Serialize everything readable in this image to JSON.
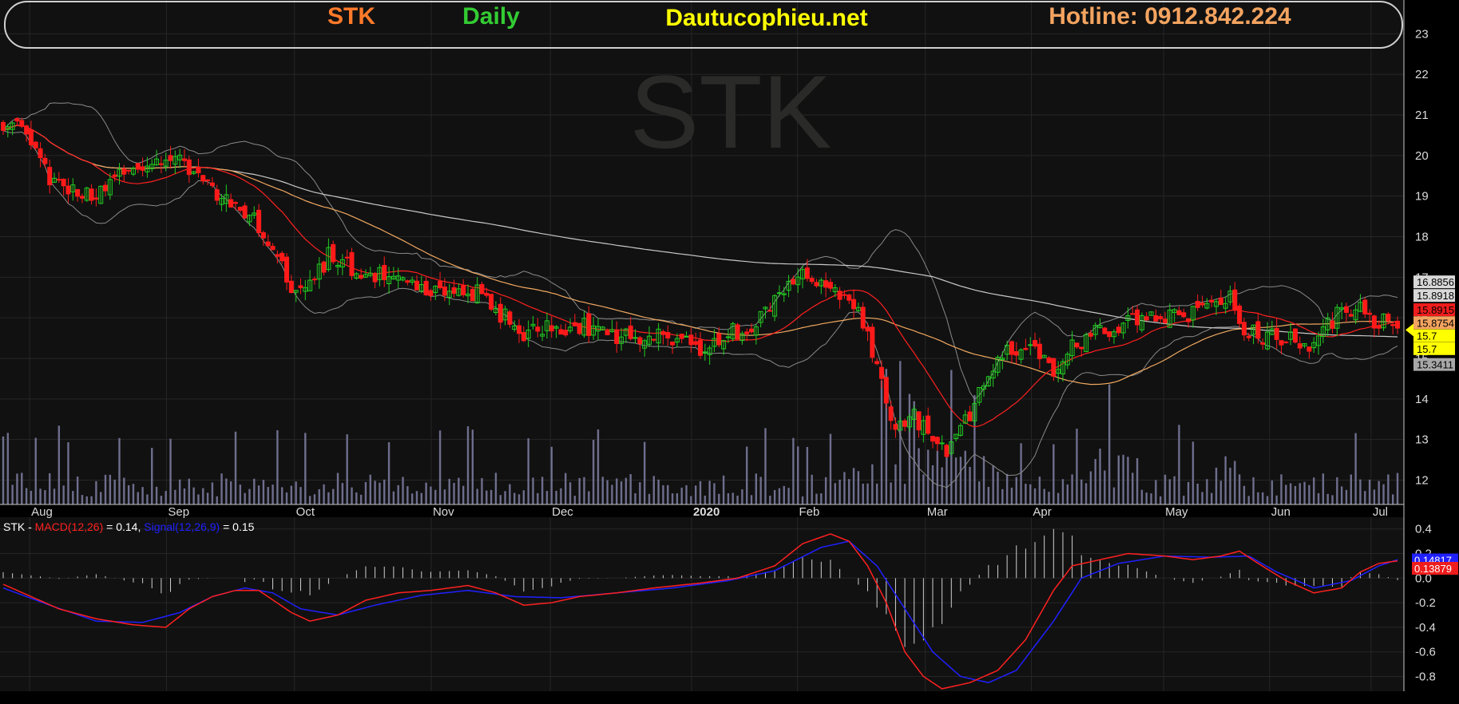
{
  "header": {
    "ticker": "STK",
    "period": "Daily",
    "site": "Dautucophieu.net",
    "hotline": "Hotline: 0912.842.224"
  },
  "watermark": "STK",
  "colors": {
    "background": "#111111",
    "up_candle": "#22cc22",
    "down_candle": "#ff1a1a",
    "ma_short": "#ff2020",
    "ma_mid": "#f0a860",
    "ma_long": "#c8c8c8",
    "bollinger": "#8a8a8a",
    "volume": "#6e6e8e",
    "macd_line": "#ff2020",
    "signal_line": "#2020ff",
    "header_ticker": "#ff7a2a",
    "header_period": "#33cc33",
    "header_site": "#ffff00",
    "header_hotline": "#f4a460"
  },
  "macd_panel": {
    "prefix": "STK - ",
    "macd_name": "MACD(12,26)",
    "macd_value": " = 0.14, ",
    "signal_name": "Signal(12,26,9)",
    "signal_value": " = 0.15"
  },
  "chart_data": [
    {
      "type": "candlestick",
      "title": "STK Daily",
      "x_axis_labels": [
        "Aug",
        "Sep",
        "Oct",
        "Nov",
        "Dec",
        "2020",
        "Feb",
        "Mar",
        "Apr",
        "May",
        "Jun",
        "Jul"
      ],
      "y_ticks": [
        12,
        13,
        14,
        15,
        16,
        17,
        18,
        19,
        20,
        21,
        22,
        23
      ],
      "ylim": [
        11.4,
        23.4
      ],
      "approx_close_path": [
        [
          0,
          20.8
        ],
        [
          5,
          20.6
        ],
        [
          10,
          19.4
        ],
        [
          20,
          19.0
        ],
        [
          28,
          19.6
        ],
        [
          35,
          20.0
        ],
        [
          42,
          19.6
        ],
        [
          48,
          18.9
        ],
        [
          53,
          18.6
        ],
        [
          58,
          17.6
        ],
        [
          62,
          16.7
        ],
        [
          66,
          17.0
        ],
        [
          70,
          17.5
        ],
        [
          76,
          17.2
        ],
        [
          82,
          17.0
        ],
        [
          88,
          16.8
        ],
        [
          96,
          16.6
        ],
        [
          103,
          16.6
        ],
        [
          108,
          16.0
        ],
        [
          112,
          15.7
        ],
        [
          118,
          15.7
        ],
        [
          126,
          15.8
        ],
        [
          134,
          15.6
        ],
        [
          142,
          15.5
        ],
        [
          150,
          15.3
        ],
        [
          156,
          15.6
        ],
        [
          162,
          15.9
        ],
        [
          168,
          16.8
        ],
        [
          174,
          17.0
        ],
        [
          180,
          16.6
        ],
        [
          184,
          16.2
        ],
        [
          188,
          14.8
        ],
        [
          191,
          13.4
        ],
        [
          196,
          13.6
        ],
        [
          200,
          13.0
        ],
        [
          204,
          12.8
        ],
        [
          208,
          13.6
        ],
        [
          212,
          14.5
        ],
        [
          216,
          15.2
        ],
        [
          222,
          15.3
        ],
        [
          226,
          14.5
        ],
        [
          230,
          15.2
        ],
        [
          234,
          15.6
        ],
        [
          240,
          15.8
        ],
        [
          246,
          16.1
        ],
        [
          252,
          16.0
        ],
        [
          258,
          16.2
        ],
        [
          264,
          16.5
        ],
        [
          266,
          15.9
        ],
        [
          270,
          15.5
        ],
        [
          276,
          15.5
        ],
        [
          280,
          15.3
        ],
        [
          286,
          16.0
        ],
        [
          292,
          16.2
        ],
        [
          296,
          15.9
        ],
        [
          300,
          15.7
        ]
      ],
      "price_labels": [
        {
          "label": "16.8856",
          "value": 16.8856,
          "bg": "#d8d8d8",
          "fg": "#000000"
        },
        {
          "label": "15.8918",
          "value": 16.55,
          "bg": "#d8d8d8",
          "fg": "#000000"
        },
        {
          "label": "15.8915",
          "value": 16.2,
          "bg": "#ee1c1c",
          "fg": "#000000"
        },
        {
          "label": "15.8754",
          "value": 15.88,
          "bg": "#f4a460",
          "fg": "#000000"
        },
        {
          "label": "15.7",
          "value": 15.56,
          "bg": "#ffff00",
          "fg": "#000000"
        },
        {
          "label": "15.7",
          "value": 15.24,
          "bg": "#ffff00",
          "fg": "#000000"
        },
        {
          "label": "15.3411",
          "value": 14.85,
          "bg": "#a8a8a8",
          "fg": "#000000"
        }
      ],
      "last_price": 15.7
    },
    {
      "type": "line",
      "title": "MACD(12,26) / Signal(12,26,9)",
      "y_ticks": [
        0.4,
        0.2,
        0.0,
        -0.2,
        -0.4,
        -0.6,
        -0.8
      ],
      "y_tick_labels": [
        "0.4",
        "0.2",
        "0.0",
        "-0.2",
        "-0.4",
        "-0.6",
        "-0.8"
      ],
      "ylim": [
        -0.92,
        0.45
      ],
      "series": [
        {
          "name": "MACD(12,26)",
          "color": "#ff2020",
          "last": 0.14
        },
        {
          "name": "Signal(12,26,9)",
          "color": "#2020ff",
          "last": 0.15
        }
      ],
      "value_tags": [
        {
          "label": "0.14817",
          "value": 0.148,
          "bg": "#2020ff",
          "fg": "#ffffff"
        },
        {
          "label": "0.13879",
          "value": 0.08,
          "bg": "#ee1c1c",
          "fg": "#ffffff"
        }
      ],
      "macd_path": [
        [
          0,
          -0.05
        ],
        [
          6,
          -0.15
        ],
        [
          12,
          -0.25
        ],
        [
          20,
          -0.33
        ],
        [
          28,
          -0.38
        ],
        [
          35,
          -0.4
        ],
        [
          40,
          -0.25
        ],
        [
          45,
          -0.15
        ],
        [
          50,
          -0.1
        ],
        [
          55,
          -0.1
        ],
        [
          62,
          -0.28
        ],
        [
          66,
          -0.35
        ],
        [
          72,
          -0.3
        ],
        [
          78,
          -0.18
        ],
        [
          85,
          -0.12
        ],
        [
          92,
          -0.1
        ],
        [
          100,
          -0.06
        ],
        [
          106,
          -0.12
        ],
        [
          112,
          -0.22
        ],
        [
          118,
          -0.2
        ],
        [
          124,
          -0.15
        ],
        [
          132,
          -0.12
        ],
        [
          140,
          -0.08
        ],
        [
          150,
          -0.04
        ],
        [
          158,
          0.0
        ],
        [
          166,
          0.1
        ],
        [
          172,
          0.28
        ],
        [
          178,
          0.36
        ],
        [
          182,
          0.3
        ],
        [
          186,
          0.1
        ],
        [
          190,
          -0.2
        ],
        [
          194,
          -0.6
        ],
        [
          198,
          -0.8
        ],
        [
          202,
          -0.9
        ],
        [
          208,
          -0.85
        ],
        [
          214,
          -0.75
        ],
        [
          220,
          -0.5
        ],
        [
          226,
          -0.1
        ],
        [
          230,
          0.1
        ],
        [
          236,
          0.15
        ],
        [
          242,
          0.2
        ],
        [
          250,
          0.18
        ],
        [
          256,
          0.15
        ],
        [
          262,
          0.18
        ],
        [
          266,
          0.22
        ],
        [
          270,
          0.12
        ],
        [
          276,
          -0.02
        ],
        [
          282,
          -0.12
        ],
        [
          288,
          -0.08
        ],
        [
          292,
          0.05
        ],
        [
          296,
          0.12
        ],
        [
          300,
          0.14
        ]
      ],
      "signal_path": [
        [
          0,
          -0.08
        ],
        [
          10,
          -0.22
        ],
        [
          20,
          -0.35
        ],
        [
          30,
          -0.36
        ],
        [
          38,
          -0.28
        ],
        [
          45,
          -0.15
        ],
        [
          52,
          -0.08
        ],
        [
          58,
          -0.12
        ],
        [
          64,
          -0.25
        ],
        [
          72,
          -0.3
        ],
        [
          80,
          -0.22
        ],
        [
          90,
          -0.14
        ],
        [
          100,
          -0.1
        ],
        [
          110,
          -0.15
        ],
        [
          120,
          -0.16
        ],
        [
          132,
          -0.12
        ],
        [
          144,
          -0.08
        ],
        [
          156,
          -0.02
        ],
        [
          166,
          0.06
        ],
        [
          176,
          0.25
        ],
        [
          182,
          0.3
        ],
        [
          188,
          0.1
        ],
        [
          194,
          -0.25
        ],
        [
          200,
          -0.6
        ],
        [
          206,
          -0.8
        ],
        [
          212,
          -0.85
        ],
        [
          218,
          -0.75
        ],
        [
          226,
          -0.35
        ],
        [
          232,
          0.0
        ],
        [
          240,
          0.12
        ],
        [
          250,
          0.18
        ],
        [
          260,
          0.17
        ],
        [
          268,
          0.18
        ],
        [
          274,
          0.05
        ],
        [
          282,
          -0.08
        ],
        [
          290,
          -0.02
        ],
        [
          296,
          0.1
        ],
        [
          300,
          0.15
        ]
      ]
    }
  ]
}
